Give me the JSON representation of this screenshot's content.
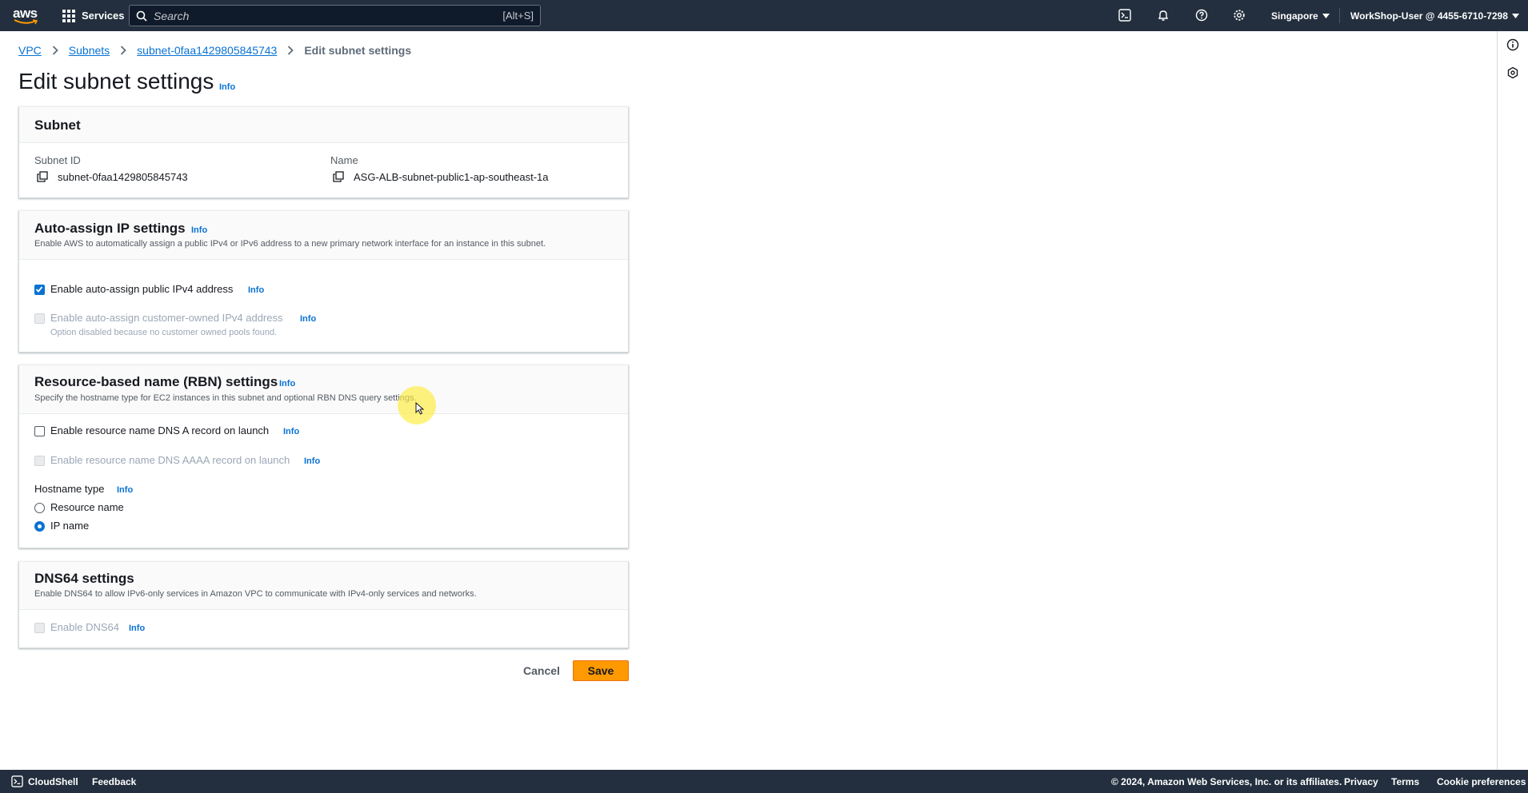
{
  "topnav": {
    "logo_text": "aws",
    "services_label": "Services",
    "search_placeholder": "Search",
    "search_shortcut": "[Alt+S]",
    "region": "Singapore",
    "user": "WorkShop-User @ 4455-6710-7298"
  },
  "breadcrumb": {
    "items": [
      "VPC",
      "Subnets",
      "subnet-0faa1429805845743"
    ],
    "current": "Edit subnet settings"
  },
  "page": {
    "title": "Edit subnet settings",
    "info": "Info"
  },
  "subnet_panel": {
    "title": "Subnet",
    "subnet_id_label": "Subnet ID",
    "subnet_id_value": "subnet-0faa1429805845743",
    "name_label": "Name",
    "name_value": "ASG-ALB-subnet-public1-ap-southeast-1a"
  },
  "auto_assign": {
    "title": "Auto-assign IP settings",
    "info": "Info",
    "description": "Enable AWS to automatically assign a public IPv4 or IPv6 address to a new primary network interface for an instance in this subnet.",
    "ipv4_label": "Enable auto-assign public IPv4 address",
    "ipv4_checked": true,
    "customer_label": "Enable auto-assign customer-owned IPv4 address",
    "customer_hint": "Option disabled because no customer owned pools found."
  },
  "rbn": {
    "title": "Resource-based name (RBN) settings",
    "info": "Info",
    "description": "Specify the hostname type for EC2 instances in this subnet and optional RBN DNS query settings.",
    "dns_a_label": "Enable resource name DNS A record on launch",
    "dns_aaaa_label": "Enable resource name DNS AAAA record on launch",
    "hostname_type_label": "Hostname type",
    "options": [
      "Resource name",
      "IP name"
    ],
    "selected": "IP name"
  },
  "dns64": {
    "title": "DNS64 settings",
    "description": "Enable DNS64 to allow IPv6-only services in Amazon VPC to communicate with IPv4-only services and networks.",
    "enable_label": "Enable DNS64",
    "info": "Info"
  },
  "actions": {
    "cancel": "Cancel",
    "save": "Save"
  },
  "footer": {
    "cloudshell": "CloudShell",
    "feedback": "Feedback",
    "copyright": "© 2024, Amazon Web Services, Inc. or its affiliates.",
    "privacy": "Privacy",
    "terms": "Terms",
    "cookies": "Cookie preferences"
  },
  "colors": {
    "nav_bg": "#232f3e",
    "link": "#0972d3",
    "primary_button": "#ff9900"
  }
}
